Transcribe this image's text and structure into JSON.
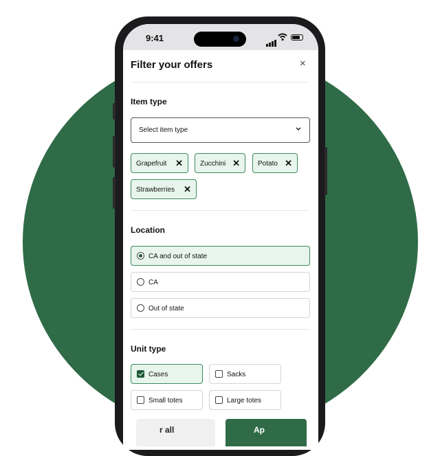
{
  "status_bar": {
    "time": "9:41"
  },
  "filter": {
    "title": "Filter your offers",
    "close_icon": "×",
    "item_type": {
      "heading": "Item type",
      "select_placeholder": "Select item type",
      "chips": [
        "Grapefruit",
        "Zucchini",
        "Potato",
        "Strawberries"
      ],
      "chip_remove_icon": "✕"
    },
    "location": {
      "heading": "Location",
      "options": [
        "CA and out of state",
        "CA",
        "Out of state"
      ],
      "selected": "CA and out of state"
    },
    "unit_type": {
      "heading": "Unit type",
      "options": [
        "Cases",
        "Sacks",
        "Small totes",
        "Large totes"
      ],
      "checked": [
        "Cases"
      ]
    },
    "actions": {
      "clear_label": "r all",
      "apply_label": "Ap"
    }
  },
  "colors": {
    "accent": "#2f6b47",
    "chip_bg": "#e8f5ec",
    "chip_border": "#3b8a5c"
  }
}
